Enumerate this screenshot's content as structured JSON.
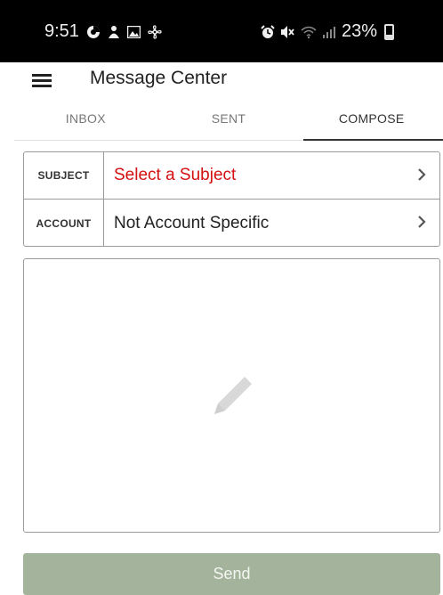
{
  "status_bar": {
    "time": "9:51",
    "battery": "23%",
    "left_icons": [
      "sync-icon",
      "person-notification-icon",
      "image-icon",
      "fan-icon"
    ],
    "right_icons": [
      "alarm-icon",
      "mute-icon",
      "wifi-icon",
      "signal-icon",
      "battery-icon"
    ]
  },
  "app_bar": {
    "title": "Message Center"
  },
  "tabs": [
    {
      "label": "INBOX",
      "active": false
    },
    {
      "label": "SENT",
      "active": false
    },
    {
      "label": "COMPOSE",
      "active": true
    }
  ],
  "form": {
    "subject": {
      "label": "SUBJECT",
      "value": "Select a Subject"
    },
    "account": {
      "label": "ACCOUNT",
      "value": "Not Account Specific"
    }
  },
  "message_area": {
    "icon": "pencil-icon"
  },
  "send_button": {
    "label": "Send"
  },
  "colors": {
    "status_bar_bg": "#000000",
    "placeholder_red": "#d41010",
    "send_button_bg": "#a4b39b",
    "border": "#9a9a9a"
  }
}
